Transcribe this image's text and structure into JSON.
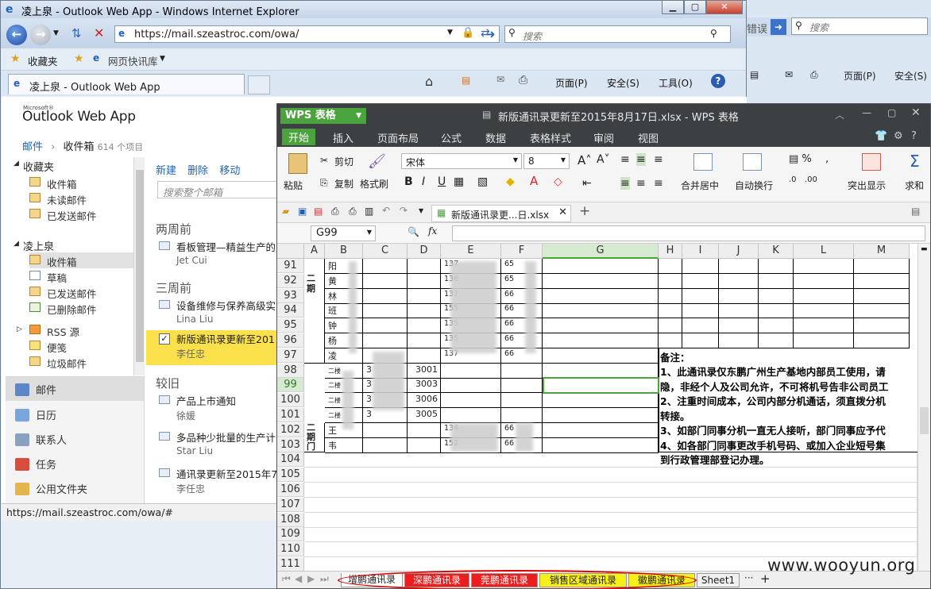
{
  "ie": {
    "title": "凌上泉 - Outlook Web App - Windows Internet Explorer",
    "url": "https://mail.szeastroc.com/owa/",
    "search_placeholder": "搜索",
    "favorites": "收藏夹",
    "quick_links": "网页快讯库",
    "tab_title": "凌上泉 - Outlook Web App",
    "cmd": {
      "page": "页面(P)",
      "safety": "安全(S)",
      "tools": "工具(O)"
    },
    "status_url": "https://mail.szeastroc.com/owa/#"
  },
  "bg_ie": {
    "error_fragment": "错误",
    "search_placeholder": "搜索",
    "page": "页面(P)",
    "safety": "安全(S)"
  },
  "owa": {
    "logo_ms": "Microsoft®",
    "logo": "Outlook Web App",
    "breadcrumb": {
      "root": "邮件",
      "folder": "收件箱",
      "count": "614 个项目"
    },
    "favorites_header": "收藏夹",
    "favorites": [
      "收件箱",
      "未读邮件",
      "已发送邮件"
    ],
    "account": "凌上泉",
    "folders": [
      "收件箱",
      "草稿",
      "已发送邮件",
      "已删除邮件",
      "RSS 源",
      "便笺",
      "垃圾邮件"
    ],
    "modules": [
      "邮件",
      "日历",
      "联系人",
      "任务",
      "公用文件夹"
    ],
    "toolbar": {
      "new": "新建",
      "delete": "删除",
      "move": "移动"
    },
    "search_placeholder": "搜索整个邮箱",
    "groups": {
      "two_weeks": "两周前",
      "three_weeks": "三周前",
      "older": "较旧"
    },
    "mails": [
      {
        "subject": "看板管理—精益生产的",
        "from": "Jet Cui"
      },
      {
        "subject": "设备维修与保养高级实",
        "from": "Lina Liu"
      },
      {
        "subject": "新版通讯录更新至201",
        "from": "李任忠"
      },
      {
        "subject": "产品上市通知",
        "from": "徐媛"
      },
      {
        "subject": "多品种少批量的生产计",
        "from": "Star Liu"
      },
      {
        "subject": "通讯录更新至2015年7",
        "from": "李任忠"
      }
    ]
  },
  "wps": {
    "app": "WPS 表格",
    "title": "新版通讯录更新至2015年8月17日.xlsx - WPS 表格",
    "menu": [
      "开始",
      "插入",
      "页面布局",
      "公式",
      "数据",
      "表格样式",
      "审阅",
      "视图"
    ],
    "ribbon": {
      "paste": "粘贴",
      "cut": "剪切",
      "copy": "复制",
      "format_painter": "格式刷",
      "font": "宋体",
      "size": "8",
      "merge": "合并居中",
      "wrap": "自动换行",
      "highlight": "突出显示",
      "sum": "求和"
    },
    "doc_tab": "新版通讯录更...日.xlsx",
    "namebox": "G99",
    "columns": [
      "A",
      "B",
      "C",
      "D",
      "E",
      "F",
      "G",
      "H",
      "I",
      "J",
      "K",
      "L",
      "M"
    ],
    "rows": [
      "91",
      "92",
      "93",
      "94",
      "95",
      "96",
      "97",
      "98",
      "99",
      "100",
      "101",
      "102",
      "103",
      "104",
      "105",
      "106",
      "107",
      "108",
      "109",
      "110",
      "111"
    ],
    "a_labels": {
      "phase2_top": "二\n期",
      "phase2_bottom": "二\n期\n门"
    },
    "b_values": [
      "阳",
      "黄",
      "林",
      "班",
      "钟",
      "杨",
      "凌",
      "二楼",
      "二楼",
      "二楼",
      "二楼",
      "王",
      "韦"
    ],
    "e_prefix": [
      "137",
      "136",
      "137",
      "155",
      "135",
      "135",
      "137",
      "",
      "",
      "",
      "",
      "134",
      "152"
    ],
    "f_prefix": [
      "65",
      "65",
      "66",
      "66",
      "66",
      "66",
      "66",
      "",
      "",
      "",
      "",
      "66",
      "66"
    ],
    "c_prefix": [
      "3",
      "3",
      "3",
      "3"
    ],
    "d_values": [
      "3001",
      "3003",
      "3006",
      "3005"
    ],
    "notes": [
      "备注：",
      "1、此通讯录仅东鹏广州生产基地内部员工使用，请",
      "隐，非经个人及公司允许，不可将机号告非公司员工",
      "2、注重时间成本，公司内部分机通话，须直拨分机",
      "转接。",
      "3、如部门同事分机一直无人接听，部门同事应予代",
      "4、如各部门同事更改手机号码、或加入企业短号集",
      "到行政管理部登记办理。"
    ],
    "sheets": [
      "增鹏通讯录",
      "深鹏通讯录",
      "莞鹏通讯录",
      "销售区域通讯录",
      "徽鹏通讯录",
      "Sheet1"
    ]
  },
  "watermark": "www.wooyun.org"
}
